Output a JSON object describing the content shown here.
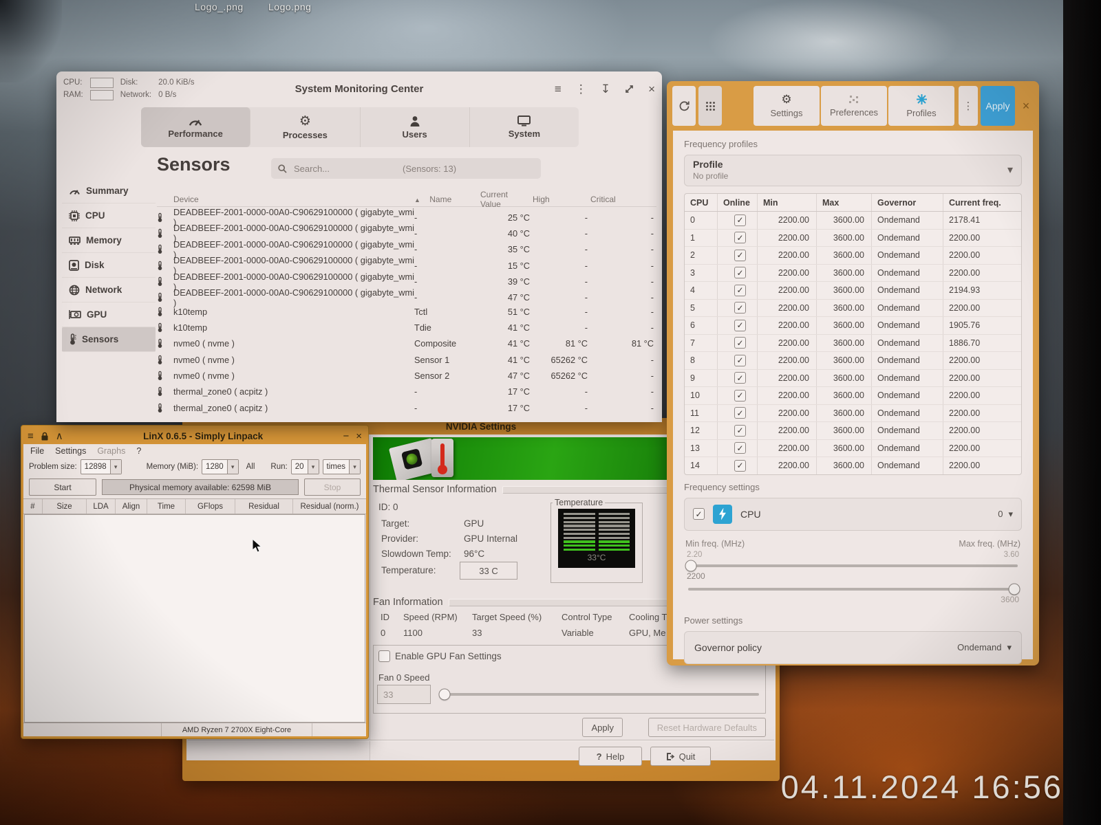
{
  "desktop": {
    "icon1": "Logo_.png",
    "icon2": "Logo.png",
    "timestamp": "04.11.2024 16:56"
  },
  "icons": {
    "menu": "≡",
    "dots": "⋮",
    "download": "↧",
    "close": "×",
    "minimize": "−",
    "caret_down": "▾",
    "sort_asc": "▲",
    "check": "✓",
    "keep_above": "∧",
    "gear": "⚙",
    "question": "?"
  },
  "smc": {
    "title": "System Monitoring Center",
    "stats": {
      "cpu_label": "CPU:",
      "ram_label": "RAM:",
      "disk_label": "Disk:",
      "disk_value": "20.0 KiB/s",
      "network_label": "Network:",
      "network_value": "0 B/s"
    },
    "tabs": [
      {
        "label": "Performance"
      },
      {
        "label": "Processes"
      },
      {
        "label": "Users"
      },
      {
        "label": "System"
      }
    ],
    "sidebar": [
      {
        "label": "Summary"
      },
      {
        "label": "CPU"
      },
      {
        "label": "Memory"
      },
      {
        "label": "Disk"
      },
      {
        "label": "Network"
      },
      {
        "label": "GPU"
      },
      {
        "label": "Sensors"
      }
    ],
    "page_title": "Sensors",
    "search_placeholder": "Search...",
    "sensor_count": "(Sensors: 13)",
    "columns": {
      "device": "Device",
      "name": "Name",
      "value": "Current Value",
      "high": "High",
      "critical": "Critical"
    },
    "rows": [
      {
        "device": "DEADBEEF-2001-0000-00A0-C90629100000 ( gigabyte_wmi )",
        "name": "-",
        "value": "25 °C",
        "high": "-",
        "critical": "-"
      },
      {
        "device": "DEADBEEF-2001-0000-00A0-C90629100000 ( gigabyte_wmi )",
        "name": "-",
        "value": "40 °C",
        "high": "-",
        "critical": "-"
      },
      {
        "device": "DEADBEEF-2001-0000-00A0-C90629100000 ( gigabyte_wmi )",
        "name": "-",
        "value": "35 °C",
        "high": "-",
        "critical": "-"
      },
      {
        "device": "DEADBEEF-2001-0000-00A0-C90629100000 ( gigabyte_wmi )",
        "name": "-",
        "value": "15 °C",
        "high": "-",
        "critical": "-"
      },
      {
        "device": "DEADBEEF-2001-0000-00A0-C90629100000 ( gigabyte_wmi )",
        "name": "-",
        "value": "39 °C",
        "high": "-",
        "critical": "-"
      },
      {
        "device": "DEADBEEF-2001-0000-00A0-C90629100000 ( gigabyte_wmi )",
        "name": "-",
        "value": "47 °C",
        "high": "-",
        "critical": "-"
      },
      {
        "device": "k10temp",
        "name": "Tctl",
        "value": "51 °C",
        "high": "-",
        "critical": "-"
      },
      {
        "device": "k10temp",
        "name": "Tdie",
        "value": "41 °C",
        "high": "-",
        "critical": "-"
      },
      {
        "device": "nvme0 ( nvme )",
        "name": "Composite",
        "value": "41 °C",
        "high": "81 °C",
        "critical": "81 °C"
      },
      {
        "device": "nvme0 ( nvme )",
        "name": "Sensor 1",
        "value": "41 °C",
        "high": "65262 °C",
        "critical": "-"
      },
      {
        "device": "nvme0 ( nvme )",
        "name": "Sensor 2",
        "value": "47 °C",
        "high": "65262 °C",
        "critical": "-"
      },
      {
        "device": "thermal_zone0 ( acpitz )",
        "name": "-",
        "value": "17 °C",
        "high": "-",
        "critical": "-"
      },
      {
        "device": "thermal_zone0 ( acpitz )",
        "name": "-",
        "value": "17 °C",
        "high": "-",
        "critical": "-"
      }
    ]
  },
  "cpupower": {
    "tabs": [
      {
        "label": "Settings"
      },
      {
        "label": "Preferences"
      },
      {
        "label": "Profiles"
      }
    ],
    "apply_label": "Apply",
    "freq_profiles_title": "Frequency profiles",
    "profile_label": "Profile",
    "profile_value": "No profile",
    "columns": {
      "cpu": "CPU",
      "online": "Online",
      "min": "Min",
      "max": "Max",
      "governor": "Governor",
      "freq": "Current freq."
    },
    "rows": [
      {
        "cpu": "0",
        "min": "2200.00",
        "max": "3600.00",
        "governor": "Ondemand",
        "freq": "2178.41"
      },
      {
        "cpu": "1",
        "min": "2200.00",
        "max": "3600.00",
        "governor": "Ondemand",
        "freq": "2200.00"
      },
      {
        "cpu": "2",
        "min": "2200.00",
        "max": "3600.00",
        "governor": "Ondemand",
        "freq": "2200.00"
      },
      {
        "cpu": "3",
        "min": "2200.00",
        "max": "3600.00",
        "governor": "Ondemand",
        "freq": "2200.00"
      },
      {
        "cpu": "4",
        "min": "2200.00",
        "max": "3600.00",
        "governor": "Ondemand",
        "freq": "2194.93"
      },
      {
        "cpu": "5",
        "min": "2200.00",
        "max": "3600.00",
        "governor": "Ondemand",
        "freq": "2200.00"
      },
      {
        "cpu": "6",
        "min": "2200.00",
        "max": "3600.00",
        "governor": "Ondemand",
        "freq": "1905.76"
      },
      {
        "cpu": "7",
        "min": "2200.00",
        "max": "3600.00",
        "governor": "Ondemand",
        "freq": "1886.70"
      },
      {
        "cpu": "8",
        "min": "2200.00",
        "max": "3600.00",
        "governor": "Ondemand",
        "freq": "2200.00"
      },
      {
        "cpu": "9",
        "min": "2200.00",
        "max": "3600.00",
        "governor": "Ondemand",
        "freq": "2200.00"
      },
      {
        "cpu": "10",
        "min": "2200.00",
        "max": "3600.00",
        "governor": "Ondemand",
        "freq": "2200.00"
      },
      {
        "cpu": "11",
        "min": "2200.00",
        "max": "3600.00",
        "governor": "Ondemand",
        "freq": "2200.00"
      },
      {
        "cpu": "12",
        "min": "2200.00",
        "max": "3600.00",
        "governor": "Ondemand",
        "freq": "2200.00"
      },
      {
        "cpu": "13",
        "min": "2200.00",
        "max": "3600.00",
        "governor": "Ondemand",
        "freq": "2200.00"
      },
      {
        "cpu": "14",
        "min": "2200.00",
        "max": "3600.00",
        "governor": "Ondemand",
        "freq": "2200.00"
      }
    ],
    "freq_settings_title": "Frequency settings",
    "cpu_row_label": "CPU",
    "cpu_selector_value": "0",
    "min_freq_label": "Min freq. (MHz)",
    "max_freq_label": "Max freq. (MHz)",
    "min_scale_top": "2.20",
    "max_scale_top": "3.60",
    "min_value": "2200",
    "max_value": "3600",
    "power_settings_title": "Power settings",
    "governor_policy_label": "Governor policy",
    "governor_policy_value": "Ondemand"
  },
  "linx": {
    "title": "LinX 0.6.5 - Simply Linpack",
    "menu": {
      "file": "File",
      "settings": "Settings",
      "graphs": "Graphs",
      "help": "?"
    },
    "problem_size_label": "Problem size:",
    "problem_size": "12898",
    "memory_label": "Memory (MiB):",
    "memory": "1280",
    "all_label": "All",
    "run_label": "Run:",
    "run_count": "20",
    "times_label": "times",
    "start_label": "Start",
    "stop_label": "Stop",
    "memory_available": "Physical memory available: 62598 MiB",
    "columns": {
      "num": "#",
      "size": "Size",
      "lda": "LDA",
      "align": "Align",
      "time": "Time",
      "gflops": "GFlops",
      "residual": "Residual",
      "residual_norm": "Residual (norm.)"
    },
    "status": "AMD Ryzen 7 2700X Eight-Core"
  },
  "nvidia": {
    "title": "NVIDIA Settings",
    "thermal": {
      "section": "Thermal Sensor Information",
      "id": "ID: 0",
      "target_label": "Target:",
      "target": "GPU",
      "provider_label": "Provider:",
      "provider": "GPU Internal",
      "slowdown_label": "Slowdown Temp:",
      "slowdown": "96°C",
      "temperature_label": "Temperature:",
      "temperature": "33 C",
      "gauge_group": "Temperature",
      "gauge_value": "33°C"
    },
    "fan": {
      "section": "Fan Information",
      "columns": {
        "id": "ID",
        "speed": "Speed (RPM)",
        "target": "Target Speed (%)",
        "control": "Control Type",
        "cooling": "Cooling T"
      },
      "row": {
        "id": "0",
        "speed": "1100",
        "target": "33",
        "control": "Variable",
        "cooling": "GPU, Me"
      },
      "enable_label": "Enable GPU Fan Settings",
      "fan0_label": "Fan 0 Speed",
      "fan0_value": "33"
    },
    "buttons": {
      "apply": "Apply",
      "reset": "Reset Hardware Defaults",
      "help": "Help",
      "quit": "Quit"
    }
  }
}
